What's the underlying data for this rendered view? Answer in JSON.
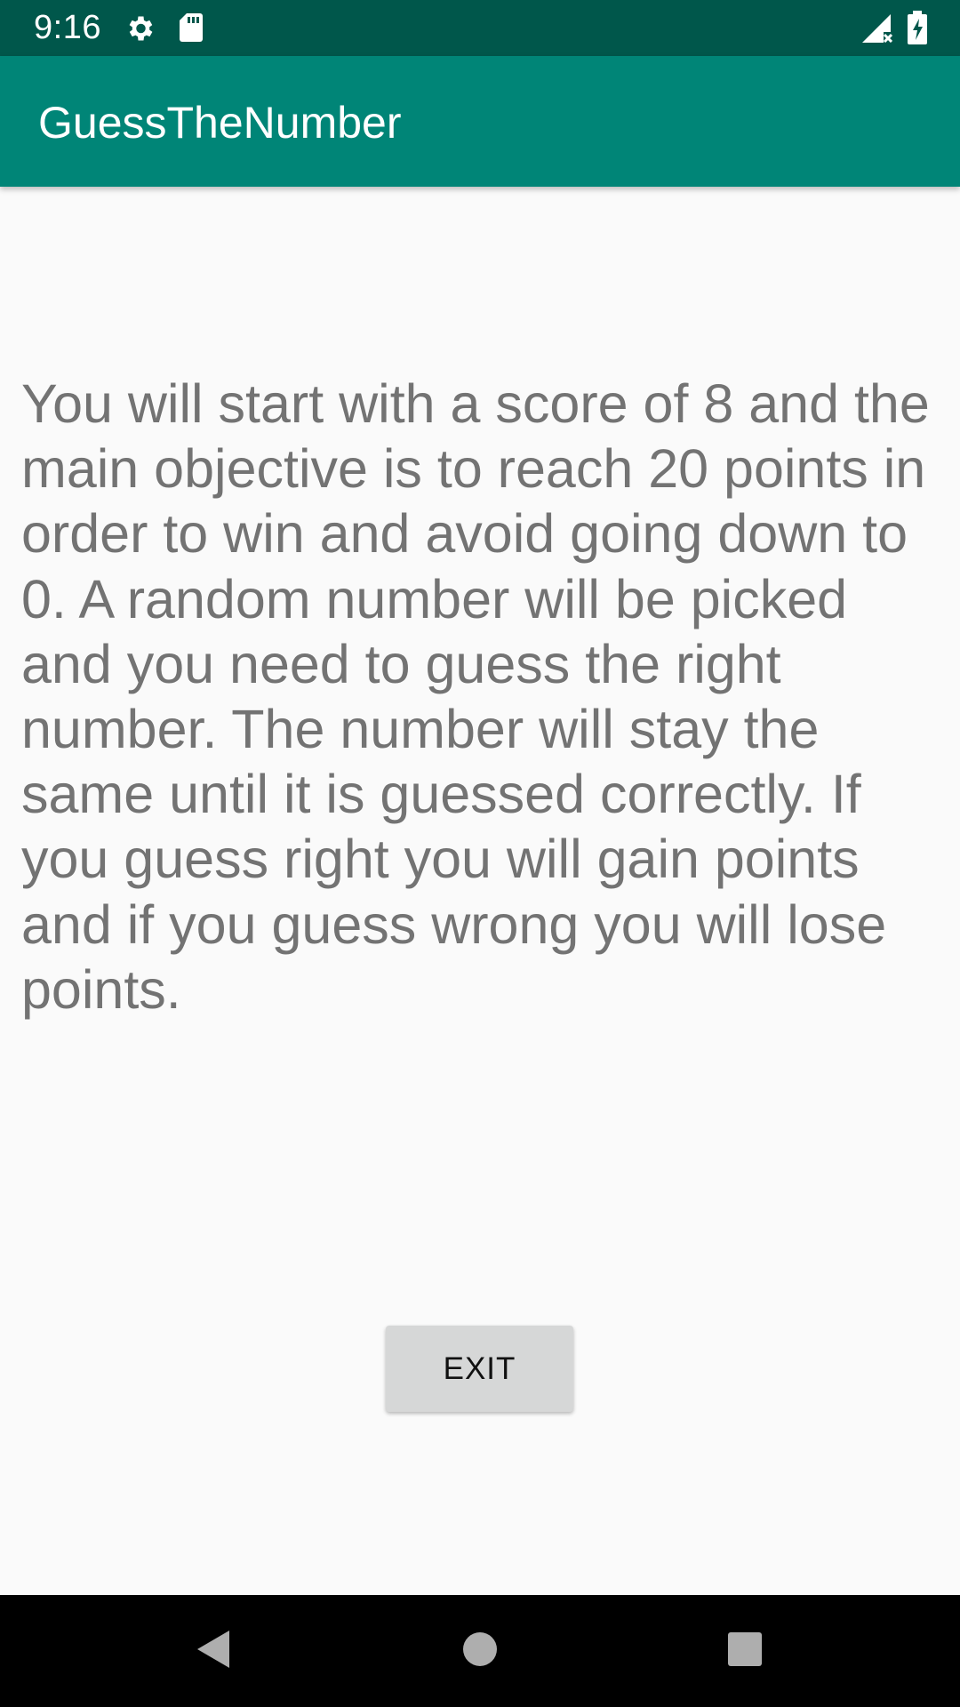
{
  "status_bar": {
    "time": "9:16",
    "icons": [
      "gear-icon",
      "sd-card-icon",
      "signal-no-data-icon",
      "battery-charging-icon"
    ]
  },
  "app_bar": {
    "title": "GuessTheNumber"
  },
  "main": {
    "instructions": "You will start with a score of 8 and the main objective is to reach 20 points in order to win and avoid going down to 0. A random number will be picked and you need to guess the right number. The number will stay the same until it is guessed correctly. If you guess right you will gain points and if you guess wrong you will lose points.",
    "exit_label": "EXIT"
  },
  "nav_bar": {
    "buttons": [
      "back-icon",
      "home-icon",
      "recents-icon"
    ]
  },
  "colors": {
    "status_bar": "#00574B",
    "app_bar": "#008577",
    "background": "#FAFAFA",
    "text": "#737373",
    "button": "#D6D7D7"
  }
}
